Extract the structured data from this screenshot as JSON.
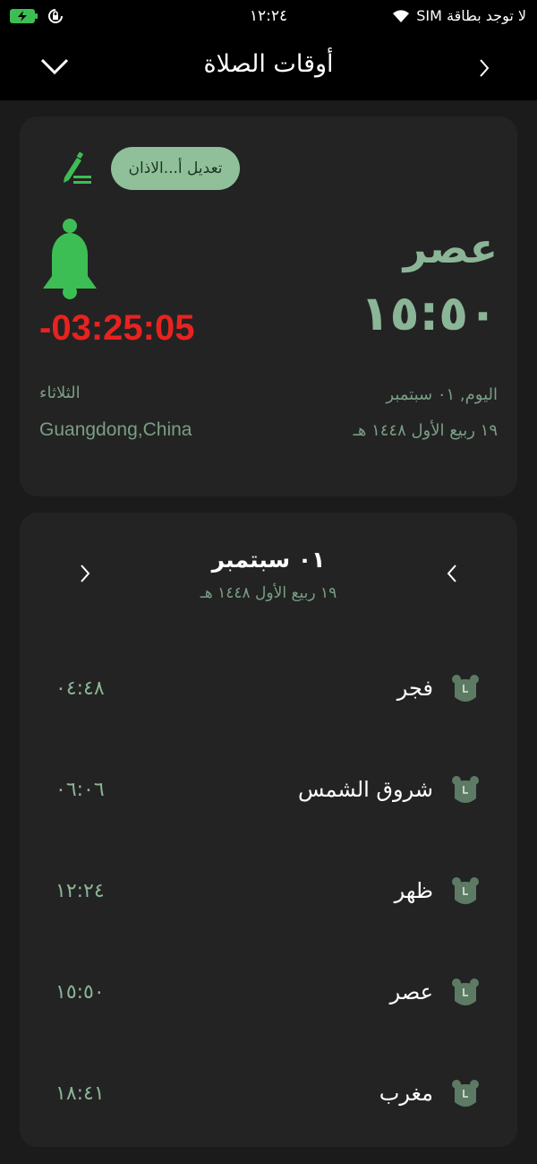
{
  "status_bar": {
    "time": "١٢:٢٤",
    "carrier": "لا توجد بطاقة SIM",
    "icons": [
      "battery-charging-icon",
      "rotation-lock-icon",
      "wifi-icon"
    ]
  },
  "nav": {
    "title": "أوقات الصلاة",
    "left_icon": "chevron-down-icon",
    "right_icon": "chevron-right-icon"
  },
  "current_card": {
    "adjust_button_label": "تعديل أ...الاذان",
    "prayer_name": "عصر",
    "prayer_time": "١٥:٥٠",
    "countdown": "-03:25:05",
    "weekday": "الثلاثاء",
    "location": "Guangdong,China",
    "gregorian_today": "اليوم, ٠١ سبتمبر",
    "hijri_date": "١٩ ربيع الأول ١٤٤٨ هـ",
    "colors": {
      "accent": "#8bb597",
      "countdown": "#e8231f",
      "bell": "#3dbe54"
    }
  },
  "schedule": {
    "date_title": "٠١ سبتمبر",
    "hijri_subtitle": "١٩ ربيع الأول ١٤٤٨ هـ",
    "prayers": [
      {
        "name": "فجر",
        "time": "٠٤:٤٨"
      },
      {
        "name": "شروق الشمس",
        "time": "٠٦:٠٦"
      },
      {
        "name": "ظهر",
        "time": "١٢:٢٤"
      },
      {
        "name": "عصر",
        "time": "١٥:٥٠"
      },
      {
        "name": "مغرب",
        "time": "١٨:٤١"
      }
    ]
  }
}
